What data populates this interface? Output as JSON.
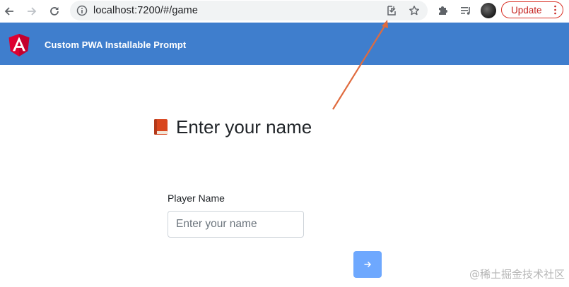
{
  "browser": {
    "url": "localhost:7200/#/game",
    "update_label": "Update"
  },
  "header": {
    "title": "Custom PWA Installable Prompt"
  },
  "form": {
    "heading": "Enter your name",
    "label": "Player Name",
    "placeholder": "Enter your name",
    "value": ""
  },
  "watermark": "@稀土掘金技术社区",
  "colors": {
    "header": "#3f7ecd",
    "submit": "#6ea8fe",
    "annotation_arrow": "#e06b3e",
    "update_border": "#d93025"
  }
}
